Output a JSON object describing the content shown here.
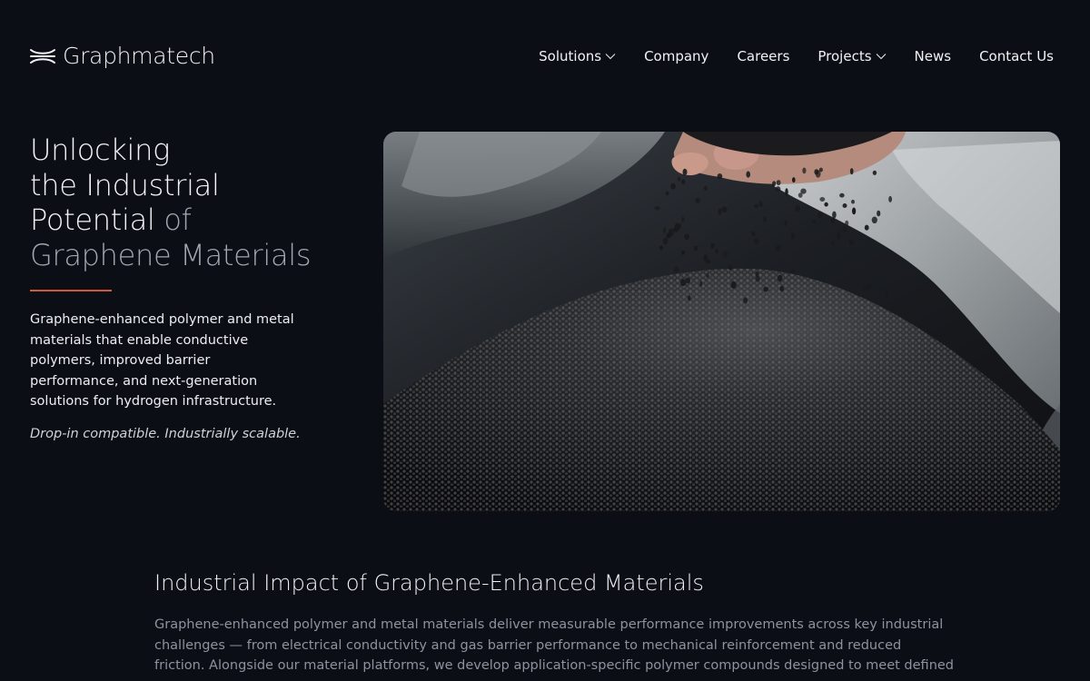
{
  "brand": {
    "name": "Graphmatech",
    "logo_icon": "wave-lines-icon"
  },
  "nav": {
    "items": [
      {
        "label": "Solutions",
        "has_dropdown": true
      },
      {
        "label": "Company",
        "has_dropdown": false
      },
      {
        "label": "Careers",
        "has_dropdown": false
      },
      {
        "label": "Projects",
        "has_dropdown": true
      },
      {
        "label": "News",
        "has_dropdown": false
      },
      {
        "label": "Contact Us",
        "has_dropdown": false
      }
    ]
  },
  "hero": {
    "title_line1": "Unlocking",
    "title_line2": "the Industrial",
    "title_line3a": "Potential",
    "title_line3b": "of",
    "title_line4": "Graphene Materials",
    "description": "Graphene-enhanced polymer and metal materials that enable conductive polymers, improved barrier performance, and next-generation solutions for hydrogen infrastructure.",
    "tagline": "Drop-in compatible. Industrially scalable.",
    "image_subject": "hand-pouring-black-granules"
  },
  "impact": {
    "title": "Industrial Impact of Graphene-Enhanced Materials",
    "body": "Graphene-enhanced polymer and metal materials deliver measurable performance improvements across key industrial challenges — from electrical conductivity and gas barrier performance to mechanical reinforcement and reduced friction. Alongside our material platforms, we develop application-specific polymer compounds designed to meet defined"
  },
  "colors": {
    "background": "#0c0e16",
    "accent": "#d2593a",
    "text_primary": "#f1f2f5",
    "text_muted": "#8e929d"
  }
}
